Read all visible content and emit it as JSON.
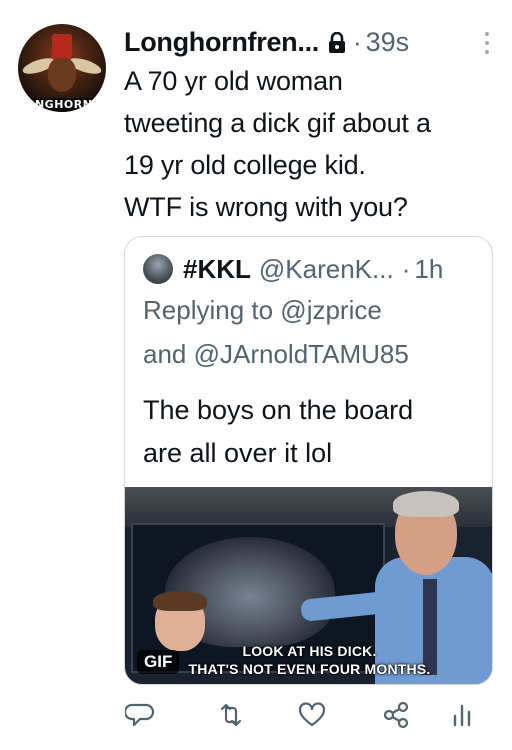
{
  "tweet": {
    "avatar_banner": "LONGHORN FR",
    "name": "Longhornfren...",
    "time": "39s",
    "text_lines": [
      "A 70 yr old woman",
      "tweeting a dick gif about a",
      "19 yr old college kid.",
      "WTF is wrong with you?"
    ]
  },
  "quote": {
    "name": "#KKL",
    "handle": "@KarenK...",
    "time": "1h",
    "reply_lines": [
      "Replying to @jzprice",
      "and @JArnoldTAMU85"
    ],
    "body_lines": [
      "The boys on the board",
      "are all over it lol"
    ],
    "gif": {
      "caption_line1": "LOOK AT HIS DICK.",
      "caption_line2": "THAT'S NOT EVEN FOUR MONTHS.",
      "badge": "GIF"
    }
  },
  "icons": {
    "lock": "lock-icon",
    "more": "more-icon",
    "reply": "reply-icon",
    "retweet": "retweet-icon",
    "like": "like-icon",
    "share": "share-icon",
    "analytics": "analytics-icon"
  },
  "colors": {
    "text": "#0f1419",
    "secondary": "#536471",
    "border": "#cfd9de",
    "icon": "#536471"
  }
}
